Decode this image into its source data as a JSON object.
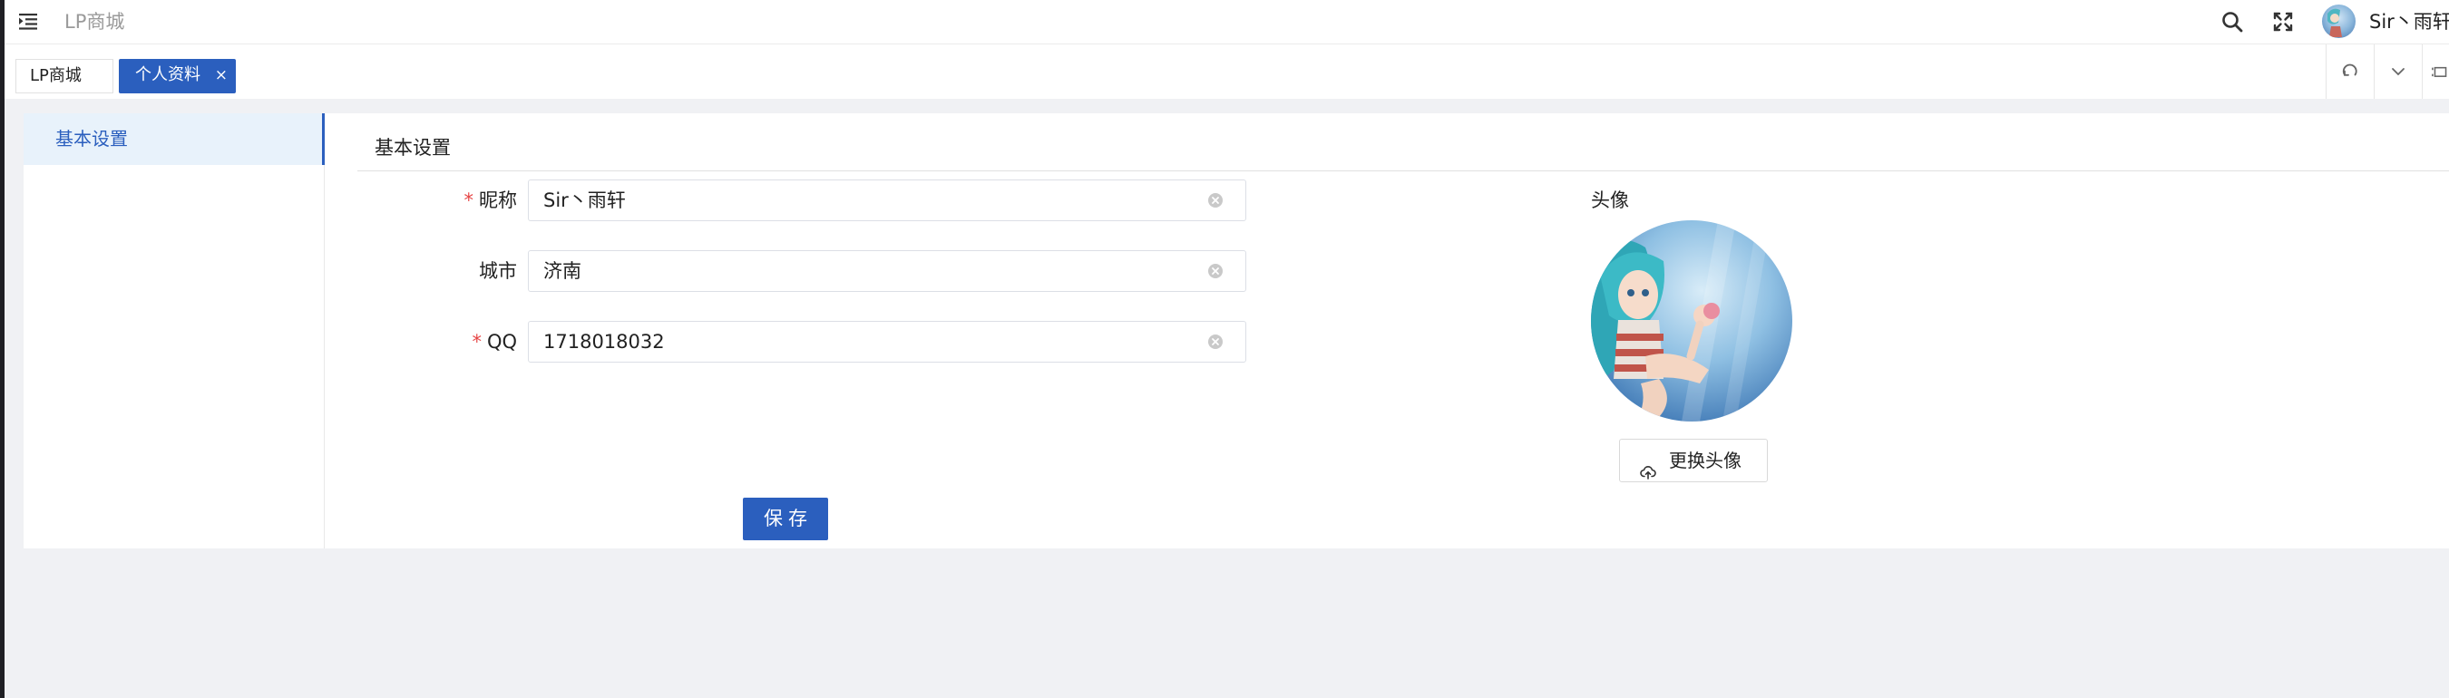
{
  "header": {
    "app_title": "LP商城",
    "user_name": "Sir丶雨轩"
  },
  "tabs": [
    {
      "label": "LP商城",
      "active": false
    },
    {
      "label": "个人资料",
      "active": true,
      "close_label": "×"
    }
  ],
  "sidebar": {
    "items": [
      {
        "label": "基本设置",
        "active": true
      }
    ]
  },
  "panel": {
    "title": "基本设置"
  },
  "form": {
    "required_mark": "*",
    "fields": [
      {
        "label": "昵称",
        "value": "Sir丶雨轩",
        "required": true
      },
      {
        "label": "城市",
        "value": "济南",
        "required": false
      },
      {
        "label": "QQ",
        "value": "1718018032",
        "required": true
      }
    ],
    "save_label": "保存"
  },
  "avatar": {
    "label": "头像",
    "change_label": "更换头像"
  },
  "colors": {
    "primary": "#2b5fbe",
    "required": "#e64545",
    "background": "#f0f1f4"
  },
  "icons": [
    "menu-fold-icon",
    "search-icon",
    "fullscreen-icon",
    "close-icon",
    "refresh-icon",
    "chevron-down-icon",
    "expand-icon",
    "clear-icon",
    "cloud-upload-icon"
  ]
}
